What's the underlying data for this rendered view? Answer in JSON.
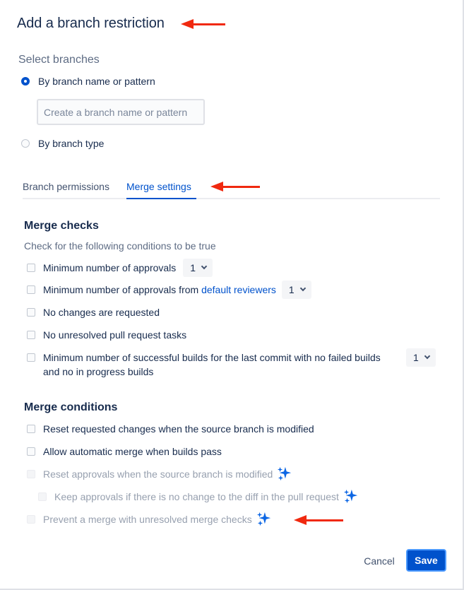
{
  "dialog": {
    "title": "Add a branch restriction"
  },
  "select_branches": {
    "heading": "Select branches",
    "option_name_pattern": "By branch name or pattern",
    "input_placeholder": "Create a branch name or pattern",
    "input_value": "",
    "option_branch_type": "By branch type",
    "selected": "By branch name or pattern"
  },
  "tabs": [
    {
      "label": "Branch permissions",
      "active": false
    },
    {
      "label": "Merge settings",
      "active": true
    }
  ],
  "merge_checks": {
    "heading": "Merge checks",
    "hint": "Check for the following conditions to be true",
    "items": [
      {
        "label": "Minimum number of approvals",
        "select_value": "1"
      },
      {
        "label_before": "Minimum number of approvals from ",
        "link": "default reviewers",
        "select_value": "1"
      },
      {
        "label": "No changes are requested"
      },
      {
        "label": "No unresolved pull request tasks"
      },
      {
        "label_line1": "Minimum number of successful builds for the last commit with no failed builds",
        "label_line2": "and no in progress builds",
        "select_value": "1"
      }
    ]
  },
  "merge_conditions": {
    "heading": "Merge conditions",
    "items": [
      {
        "label": "Reset requested changes when the source branch is modified",
        "disabled": false
      },
      {
        "label": "Allow automatic merge when builds pass",
        "disabled": false
      },
      {
        "label": "Reset approvals when the source branch is modified",
        "disabled": true,
        "icon": "sparkle-icon"
      },
      {
        "label": "Keep approvals if there is no change to the diff in the pull request",
        "disabled": true,
        "icon": "sparkle-icon"
      },
      {
        "label": "Prevent a merge with unresolved merge checks",
        "disabled": true,
        "icon": "sparkle-icon"
      }
    ]
  },
  "footer": {
    "cancel_label": "Cancel",
    "save_label": "Save"
  },
  "colors": {
    "primary": "#0052cc",
    "annotation_arrow": "#f0290f",
    "sparkle": "#0c66e4"
  }
}
